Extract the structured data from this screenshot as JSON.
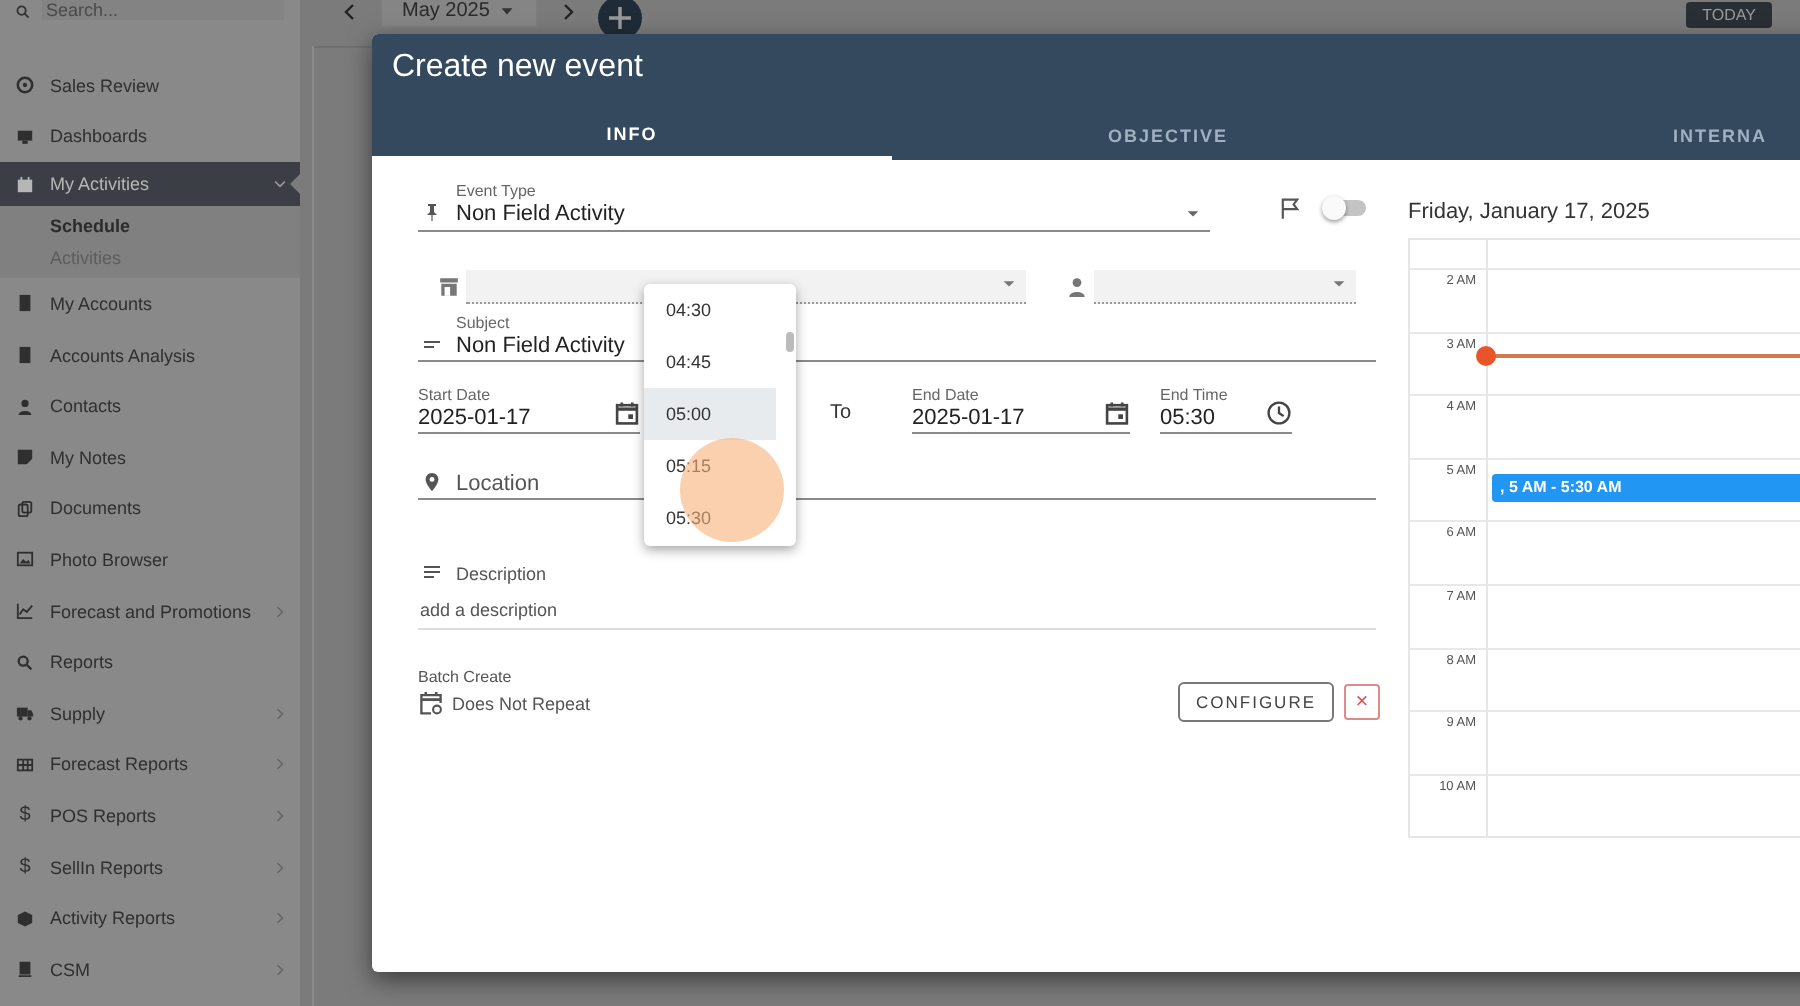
{
  "sidebar": {
    "search_placeholder": "Search...",
    "items": [
      {
        "label": "Sales Review",
        "selected": false
      },
      {
        "label": "Dashboards",
        "selected": false
      },
      {
        "label": "My Activities",
        "expanded": true,
        "selected": true,
        "children": [
          {
            "label": "Schedule",
            "selected": true
          },
          {
            "label": "Activities",
            "selected": false
          }
        ]
      },
      {
        "label": "My Accounts",
        "selected": false
      },
      {
        "label": "Accounts Analysis",
        "selected": false
      },
      {
        "label": "Contacts",
        "selected": false
      },
      {
        "label": "My Notes",
        "selected": false
      },
      {
        "label": "Documents",
        "selected": false
      },
      {
        "label": "Photo Browser",
        "selected": false
      },
      {
        "label": "Forecast and Promotions",
        "expanded": false,
        "selected": false
      },
      {
        "label": "Reports",
        "selected": false
      },
      {
        "label": "Supply",
        "expanded": false,
        "selected": false
      },
      {
        "label": "Forecast Reports",
        "expanded": false,
        "selected": false
      },
      {
        "label": "POS Reports",
        "icon_text": "$",
        "expanded": false,
        "selected": false
      },
      {
        "label": "SellIn Reports",
        "icon_text": "$",
        "expanded": false,
        "selected": false
      },
      {
        "label": "Activity Reports",
        "expanded": false,
        "selected": false
      },
      {
        "label": "CSM",
        "expanded": false,
        "selected": false
      }
    ]
  },
  "toolbar": {
    "month": "May 2025",
    "today": "TODAY"
  },
  "dialog": {
    "title": "Create new event",
    "tabs": [
      {
        "label": "INFO",
        "selected": true
      },
      {
        "label": "OBJECTIVE",
        "selected": false
      },
      {
        "label": "INTERNA",
        "selected": false
      }
    ],
    "form": {
      "event_type": {
        "label": "Event Type",
        "value": "Non Field Activity"
      },
      "flag_toggle": {
        "on": false
      },
      "account_select": {
        "disabled": true
      },
      "contact_select": {
        "disabled": true
      },
      "subject": {
        "label": "Subject",
        "value": "Non Field Activity"
      },
      "start_date": {
        "label": "Start Date",
        "value": "2025-01-17"
      },
      "to_label": "To",
      "end_date": {
        "label": "End Date",
        "value": "2025-01-17"
      },
      "end_time": {
        "label": "End Time",
        "value": "05:30"
      },
      "location": {
        "placeholder": "Location"
      },
      "description": {
        "label": "Description",
        "placeholder": "add a description"
      },
      "batch_create": {
        "label": "Batch Create",
        "value": "Does Not Repeat",
        "configure": "CONFIGURE",
        "remove": "×"
      },
      "time_options": [
        {
          "label": "04:30",
          "selected": false
        },
        {
          "label": "04:45",
          "selected": false
        },
        {
          "label": "05:00",
          "selected": true
        },
        {
          "label": "05:15",
          "selected": false
        },
        {
          "label": "05:30",
          "selected": false
        }
      ]
    },
    "calendar": {
      "date": "Friday, January 17, 2025",
      "hours": [
        {
          "label": "2 AM"
        },
        {
          "label": "3 AM",
          "now_marker": true
        },
        {
          "label": "4 AM"
        },
        {
          "label": "5 AM",
          "events": [
            {
              "label": ", 5 AM - 5:30 AM",
              "color": "#2196f3"
            }
          ]
        },
        {
          "label": "6 AM"
        },
        {
          "label": "7 AM"
        },
        {
          "label": "8 AM"
        },
        {
          "label": "9 AM"
        },
        {
          "label": "10 AM"
        }
      ]
    }
  }
}
